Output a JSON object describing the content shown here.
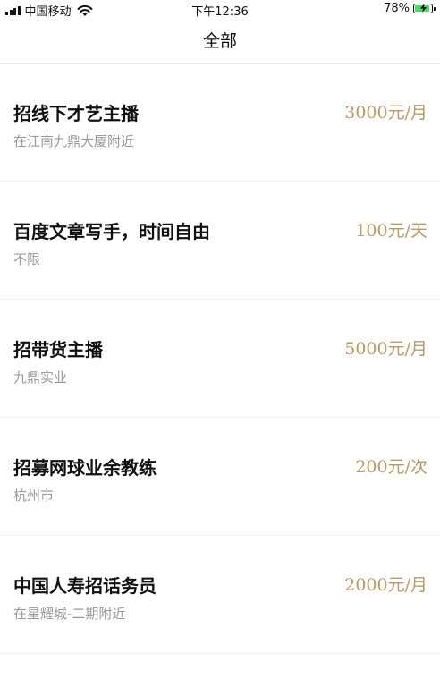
{
  "status_bar": {
    "carrier": "中国移动",
    "time": "下午12:36",
    "battery_percent": "78%",
    "battery_level": 0.78,
    "icons": [
      "signal-icon",
      "wifi-icon",
      "battery-charging-icon"
    ]
  },
  "nav": {
    "title": "全部"
  },
  "jobs": [
    {
      "title": "招线下才艺主播",
      "location": "在江南九鼎大厦附近",
      "salary": "3000元/月"
    },
    {
      "title": "百度文章写手，时间自由",
      "location": "不限",
      "salary": "100元/天"
    },
    {
      "title": "招带货主播",
      "location": "九鼎实业",
      "salary": "5000元/月"
    },
    {
      "title": "招募网球业余教练",
      "location": "杭州市",
      "salary": "200元/次"
    },
    {
      "title": "中国人寿招话务员",
      "location": "在星耀城-二期附近",
      "salary": "2000元/月"
    }
  ],
  "colors": {
    "salary": "#b99a66",
    "subtitle": "#9a9a9a",
    "divider": "#eeeeee",
    "battery_fill": "#4cd964"
  }
}
